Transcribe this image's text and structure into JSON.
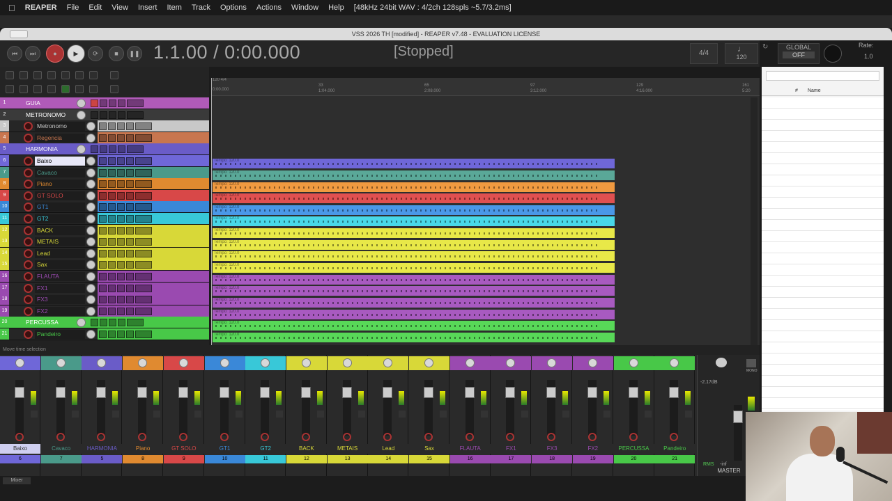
{
  "menubar": {
    "app": "REAPER",
    "items": [
      "File",
      "Edit",
      "View",
      "Insert",
      "Item",
      "Track",
      "Options",
      "Actions",
      "Window",
      "Help"
    ],
    "format": "[48kHz 24bit WAV : 4/2ch 128spls ~5.7/3.2ms]"
  },
  "window": {
    "title": "VSS 2026 TH [modified] - REAPER v7.48 - EVALUATION LICENSE"
  },
  "transport": {
    "time": "1.1.00 / 0:00.000",
    "status": "[Stopped]",
    "timesig": "4/4",
    "bpm": "120",
    "global_label": "GLOBAL",
    "global_state": "OFF",
    "rate_label": "Rate:",
    "rate_value": "1.0"
  },
  "ruler": {
    "marks": [
      "120 4/4",
      "33",
      "65",
      "97",
      "129",
      "161"
    ],
    "times": [
      "0:00.000",
      "1:04.000",
      "2:08.000",
      "3:12.000",
      "4:16.000",
      "5:20"
    ]
  },
  "tracks": [
    {
      "num": "1",
      "name": "GUIA",
      "color": "#b05ab8",
      "folder": true
    },
    {
      "num": "2",
      "name": "METRONOMO",
      "color": "#3a3a3a",
      "folder": true
    },
    {
      "num": "3",
      "name": "Metronomo",
      "color": "#c8c8c8",
      "folder": false
    },
    {
      "num": "4",
      "name": "Regencia",
      "color": "#c8764f",
      "folder": false
    },
    {
      "num": "5",
      "name": "HARMONIA",
      "color": "#6a5cc8",
      "folder": true
    },
    {
      "num": "6",
      "name": "Baixo",
      "color": "#6f67d8",
      "folder": false
    },
    {
      "num": "7",
      "name": "Cavaco",
      "color": "#4a9a8a",
      "folder": false
    },
    {
      "num": "8",
      "name": "Piano",
      "color": "#e08a30",
      "folder": false
    },
    {
      "num": "9",
      "name": "GT SOLO",
      "color": "#d84848",
      "folder": false
    },
    {
      "num": "10",
      "name": "GT1",
      "color": "#3a88d8",
      "folder": false
    },
    {
      "num": "11",
      "name": "GT2",
      "color": "#38c8d8",
      "folder": false
    },
    {
      "num": "12",
      "name": "BACK",
      "color": "#d8d838",
      "folder": false
    },
    {
      "num": "13",
      "name": "METAIS",
      "color": "#d8d838",
      "folder": false
    },
    {
      "num": "14",
      "name": "Lead",
      "color": "#d8d838",
      "folder": false
    },
    {
      "num": "15",
      "name": "Sax",
      "color": "#d8d838",
      "folder": false
    },
    {
      "num": "16",
      "name": "FLAUTA",
      "color": "#9a4ab0",
      "folder": false
    },
    {
      "num": "17",
      "name": "FX1",
      "color": "#9a4ab0",
      "folder": false
    },
    {
      "num": "18",
      "name": "FX3",
      "color": "#9a4ab0",
      "folder": false
    },
    {
      "num": "19",
      "name": "FX2",
      "color": "#9a4ab0",
      "folder": false
    },
    {
      "num": "20",
      "name": "PERCUSSA",
      "color": "#48c848",
      "folder": true
    },
    {
      "num": "21",
      "name": "Pandeiro",
      "color": "#48c848",
      "folder": false
    }
  ],
  "items": [
    {
      "label": "Tempo: 120.0",
      "color": "#6f67d8"
    },
    {
      "label": "Tempo: 120.0",
      "color": "#5aa898"
    },
    {
      "label": "Tempo: 120.0",
      "color": "#f09a40"
    },
    {
      "label": "Tempo: 120.0",
      "color": "#e05050"
    },
    {
      "label": "Tempo: 120.0",
      "color": "#4a98e8"
    },
    {
      "label": "Tempo: 120.0",
      "color": "#48d8e8"
    },
    {
      "label": "Tempo: 120.0",
      "color": "#e8e848"
    },
    {
      "label": "Tempo: 120.0",
      "color": "#e8e848"
    },
    {
      "label": "Tempo: 120.0",
      "color": "#e8e848"
    },
    {
      "label": "Tempo: 120.0",
      "color": "#e8e848"
    },
    {
      "label": "Tempo: 120.0",
      "color": "#a85ac0"
    },
    {
      "label": "Tempo: 120.0",
      "color": "#a85ac0"
    },
    {
      "label": "Tempo: 120.0",
      "color": "#a85ac0"
    },
    {
      "label": "Tempo: 120.0",
      "color": "#a85ac0"
    },
    {
      "label": "Tempo: 120.0",
      "color": "#58d858"
    },
    {
      "label": "Tempo: 120.0",
      "color": "#58d858"
    }
  ],
  "info": "Move time selection",
  "rightpanel": {
    "col_num": "#",
    "col_name": "Name"
  },
  "mixer": {
    "strips": [
      {
        "name": "Baixo",
        "num": "6",
        "color": "#6f67d8",
        "name_bg": "#cfcff0"
      },
      {
        "name": "Cavaco",
        "num": "7",
        "color": "#4a9a8a",
        "name_bg": "#2a2a2a"
      },
      {
        "name": "HARMONIA",
        "num": "5",
        "color": "#6a5cc8",
        "name_bg": "#2a2a2a"
      },
      {
        "name": "Piano",
        "num": "8",
        "color": "#e08a30",
        "name_bg": "#2a2a2a"
      },
      {
        "name": "GT SOLO",
        "num": "9",
        "color": "#d84848",
        "name_bg": "#2a2a2a"
      },
      {
        "name": "GT1",
        "num": "10",
        "color": "#3a88d8",
        "name_bg": "#2a2a2a"
      },
      {
        "name": "GT2",
        "num": "11",
        "color": "#38c8d8",
        "name_bg": "#2a2a2a"
      },
      {
        "name": "BACK",
        "num": "12",
        "color": "#d8d838",
        "name_bg": "#2a2a2a"
      },
      {
        "name": "METAIS",
        "num": "13",
        "color": "#d8d838",
        "name_bg": "#2a2a2a"
      },
      {
        "name": "Lead",
        "num": "14",
        "color": "#d8d838",
        "name_bg": "#2a2a2a"
      },
      {
        "name": "Sax",
        "num": "15",
        "color": "#d8d838",
        "name_bg": "#2a2a2a"
      },
      {
        "name": "FLAUTA",
        "num": "16",
        "color": "#9a4ab0",
        "name_bg": "#2a2a2a"
      },
      {
        "name": "FX1",
        "num": "17",
        "color": "#9a4ab0",
        "name_bg": "#2a2a2a"
      },
      {
        "name": "FX3",
        "num": "18",
        "color": "#9a4ab0",
        "name_bg": "#2a2a2a"
      },
      {
        "name": "FX2",
        "num": "19",
        "color": "#9a4ab0",
        "name_bg": "#2a2a2a"
      },
      {
        "name": "PERCUSSA",
        "num": "20",
        "color": "#48c848",
        "name_bg": "#2a2a2a"
      },
      {
        "name": "Pandeiro",
        "num": "21",
        "color": "#48c848",
        "name_bg": "#2a2a2a"
      }
    ],
    "master": {
      "label": "MASTER",
      "db": "-2.17dB",
      "mono": "MONO",
      "rms": "RMS",
      "inf": "-inf"
    },
    "tab": "Mixer"
  }
}
